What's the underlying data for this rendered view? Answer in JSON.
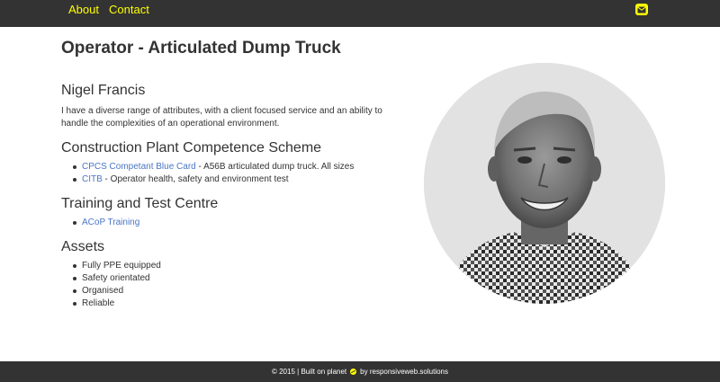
{
  "nav": {
    "about_label": "About",
    "contact_label": "Contact",
    "accent_color": "#ffff00",
    "contact_icon": "envelope-icon"
  },
  "page": {
    "title": "Operator - Articulated Dump Truck"
  },
  "profile": {
    "name": "Nigel Francis",
    "summary": "I have a diverse range of attributes, with a client focused service and an ability to handle the complexities of an operational environment."
  },
  "sections": {
    "cpcs": {
      "heading": "Construction Plant Competence Scheme",
      "items": [
        {
          "link": "CPCS Competant Blue Card",
          "text": " - A56B articulated dump truck. All sizes"
        },
        {
          "link": "CITB",
          "text": " - Operator health, safety and environment test"
        }
      ]
    },
    "training": {
      "heading": "Training and Test Centre",
      "items": [
        {
          "link": "ACoP Training"
        }
      ]
    },
    "assets": {
      "heading": "Assets",
      "items": [
        "Fully PPE equipped",
        "Safety orientated",
        "Organised",
        "Reliable"
      ]
    }
  },
  "footer": {
    "copyright": "© 2015",
    "separator": "|",
    "built_on": "Built on planet",
    "by_text": "by responsiveweb.solutions",
    "icon": "planet-icon"
  }
}
